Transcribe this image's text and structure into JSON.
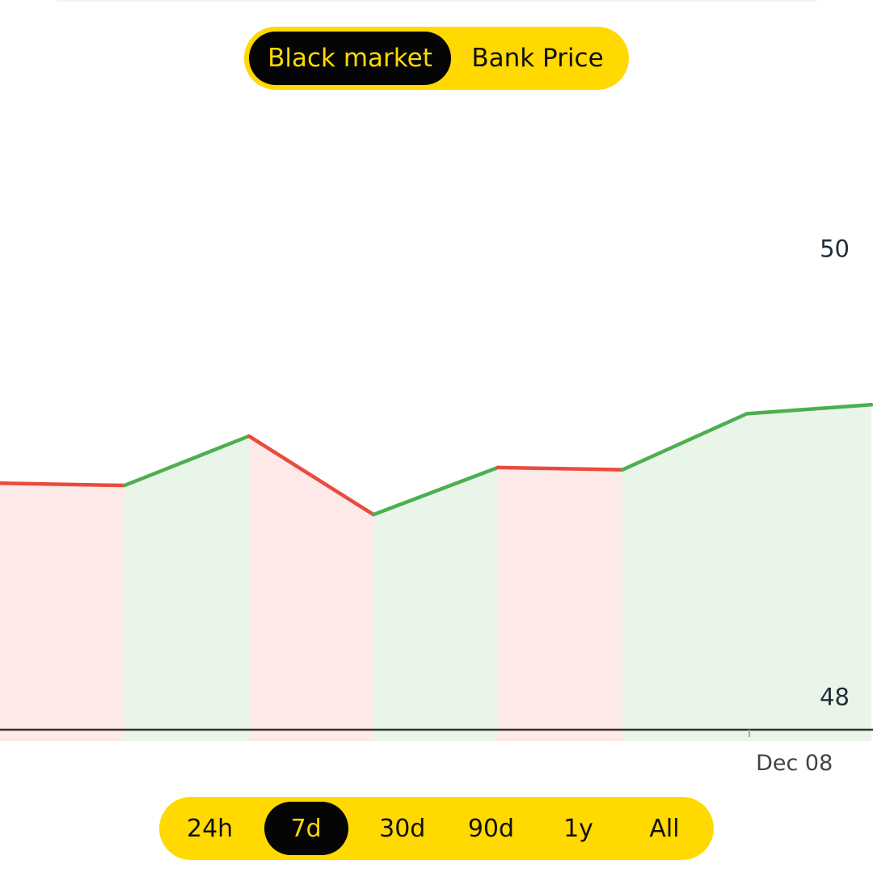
{
  "market_toggle": {
    "options": [
      "Black market",
      "Bank Price"
    ],
    "active_index": 0
  },
  "range_toggle": {
    "options": [
      "24h",
      "7d",
      "30d",
      "90d",
      "1y",
      "All"
    ],
    "active_index": 1
  },
  "colors": {
    "accent": "#ffd900",
    "dark": "#050505",
    "up": "#4caf50",
    "down": "#e94b3c",
    "up_fill": "#eaf5ea",
    "down_fill": "#fde9e7",
    "axis": "#333333",
    "label": "#1f2c36"
  },
  "chart_data": {
    "type": "area",
    "title": "",
    "xlabel": "",
    "ylabel": "",
    "x": [
      "",
      "",
      "",
      "",
      "",
      "",
      "",
      "Dec 08"
    ],
    "values": [
      48.95,
      48.94,
      49.16,
      48.81,
      49.02,
      49.01,
      49.26,
      49.3
    ],
    "y_ticks": [
      50,
      48
    ],
    "x_tick_labels": [
      "Dec 08"
    ],
    "x_tick_index": 6.02,
    "ylim": [
      47.8,
      50.6
    ],
    "grid": false,
    "colors_by_direction": true
  }
}
